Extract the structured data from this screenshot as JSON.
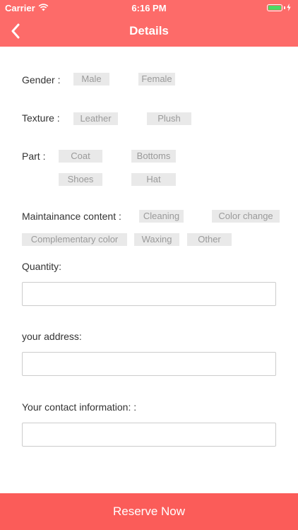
{
  "status_bar": {
    "carrier": "Carrier",
    "time": "6:16 PM",
    "wifi_icon": "wifi-icon",
    "battery_icon": "battery-icon"
  },
  "nav": {
    "title": "Details",
    "back_icon": "chevron-left-icon"
  },
  "gender": {
    "label": "Gender :",
    "options": [
      "Male",
      "Female"
    ]
  },
  "texture": {
    "label": "Texture :",
    "options": [
      "Leather",
      "Plush"
    ]
  },
  "part": {
    "label": "Part :",
    "options": [
      "Coat",
      "Bottoms",
      "Shoes",
      "Hat"
    ]
  },
  "maintenance": {
    "label": "Maintainance content :",
    "options": [
      "Cleaning",
      "Color change",
      "Complementary color",
      "Waxing",
      "Other"
    ]
  },
  "quantity": {
    "label": "Quantity:",
    "value": "",
    "placeholder": ""
  },
  "address": {
    "label": "your address:",
    "value": "",
    "placeholder": ""
  },
  "contact": {
    "label": "Your contact information: :",
    "value": "",
    "placeholder": ""
  },
  "reserve_button": {
    "label": "Reserve Now"
  },
  "colors": {
    "header": "#fd6b69",
    "button": "#fb5c59",
    "chip_bg": "#e9e9e9",
    "chip_text": "#9a9a9a"
  }
}
